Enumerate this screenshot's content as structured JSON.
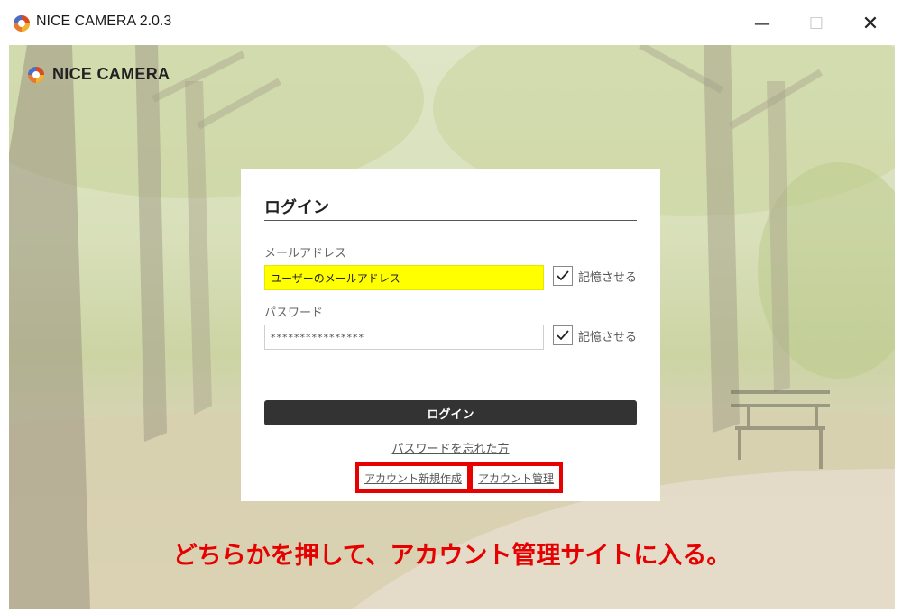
{
  "window": {
    "title": "NICE CAMERA 2.0.3",
    "minimize_glyph": "—",
    "maximize_glyph": "☐",
    "close_glyph": "✕"
  },
  "brand": {
    "name": "NICE CAMERA",
    "icon": "camera-aperture-icon"
  },
  "login": {
    "title": "ログイン",
    "email_label": "メールアドレス",
    "email_value": "ユーザーのメールアドレス",
    "email_remember_label": "記憶させる",
    "email_remember_checked": true,
    "password_label": "パスワード",
    "password_value": "****************",
    "password_remember_label": "記憶させる",
    "password_remember_checked": true,
    "submit_label": "ログイン",
    "forgot_link": "パスワードを忘れた方",
    "create_account_link": "アカウント新規作成",
    "manage_account_link": "アカウント管理"
  },
  "annotation": "どちらかを押して、アカウント管理サイトに入る。",
  "colors": {
    "highlight_box": "#e60000",
    "email_highlight": "#ffff00",
    "button_dark": "#333333"
  }
}
